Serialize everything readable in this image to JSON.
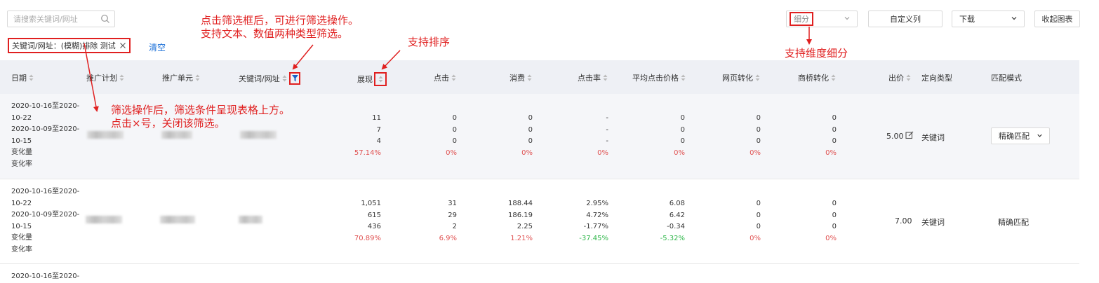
{
  "toolbar": {
    "search_placeholder": "请搜索关键词/网址",
    "dimension_select": "细分",
    "custom_columns": "自定义列",
    "download": "下载",
    "collapse_chart": "收起图表"
  },
  "filter": {
    "chip_label": "关键词/网址：(模糊)排除 测试",
    "clear_label": "清空"
  },
  "annotations": {
    "filter_box_line1": "点击筛选框后，可进行筛选操作。",
    "filter_box_line2": "支持文本、数值两种类型筛选。",
    "sort": "支持排序",
    "dimension": "支持维度细分",
    "chip_line1": "筛选操作后，筛选条件呈现表格上方。",
    "chip_line2": "点击×号，关闭该筛选。"
  },
  "columns": {
    "date": "日期",
    "plan": "推广计划",
    "unit": "推广单元",
    "keyword": "关键词/网址",
    "impressions": "展现",
    "clicks": "点击",
    "cost": "消费",
    "ctr": "点击率",
    "cpc": "平均点击价格",
    "web_conv": "网页转化",
    "bridge_conv": "商桥转化",
    "bid": "出价",
    "target_type": "定向类型",
    "match_mode": "匹配模式"
  },
  "rows": [
    {
      "date_lines": [
        "2020-10-16至2020-",
        "10-22",
        "2020-10-09至2020-",
        "10-15",
        "变化量",
        "变化率"
      ],
      "impressions": [
        "11",
        "7",
        "4",
        "57.14%"
      ],
      "clicks": [
        "0",
        "0",
        "0",
        "0%"
      ],
      "cost": [
        "0",
        "0",
        "0",
        "0%"
      ],
      "ctr": [
        "-",
        "-",
        "-",
        "0%"
      ],
      "cpc": [
        "0",
        "0",
        "0",
        "0%"
      ],
      "web_conv": [
        "0",
        "0",
        "0",
        "0%"
      ],
      "bridge_conv": [
        "0",
        "0",
        "0",
        "0%"
      ],
      "bid": "5.00",
      "target_type": "关键词",
      "match_mode": "精确匹配"
    },
    {
      "date_lines": [
        "2020-10-16至2020-",
        "10-22",
        "2020-10-09至2020-",
        "10-15",
        "变化量",
        "变化率"
      ],
      "impressions": [
        "1,051",
        "615",
        "436",
        "70.89%"
      ],
      "clicks": [
        "31",
        "29",
        "2",
        "6.9%"
      ],
      "cost": [
        "188.44",
        "186.19",
        "2.25",
        "1.21%"
      ],
      "ctr": [
        "2.95%",
        "4.72%",
        "-1.77%",
        "-37.45%"
      ],
      "cpc": [
        "6.08",
        "6.42",
        "-0.34",
        "-5.32%"
      ],
      "web_conv": [
        "0",
        "0",
        "0",
        "0%"
      ],
      "bridge_conv": [
        "0",
        "0",
        "0",
        "0%"
      ],
      "bid": "7.00",
      "target_type": "关键词",
      "match_mode": "精确匹配"
    },
    {
      "date_lines": [
        "2020-10-16至2020-"
      ]
    }
  ],
  "colors": {
    "annotation_red": "#e02020",
    "link_blue": "#1a6fd8",
    "header_bg": "#eef0f5",
    "negative_green": "#2fb74a",
    "rate_red": "#e05252"
  }
}
